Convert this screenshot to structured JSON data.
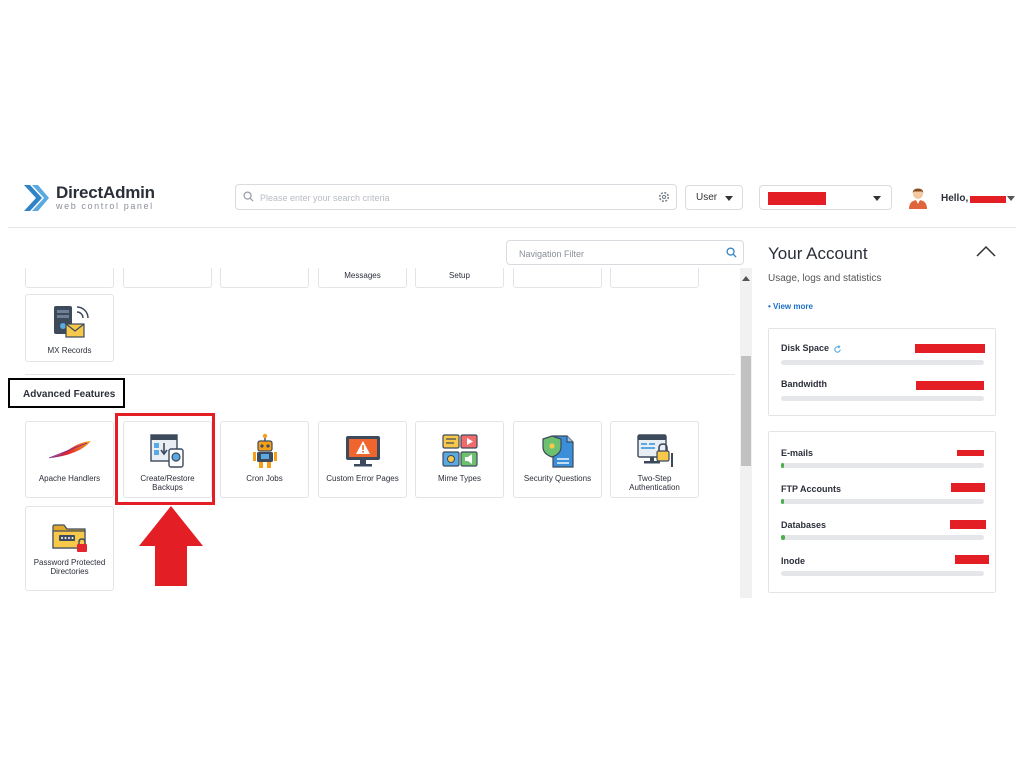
{
  "header": {
    "brand": "DirectAdmin",
    "tagline": "web control panel",
    "search_placeholder": "Please enter your search criteria",
    "role_select": "User",
    "greeting": "Hello,"
  },
  "nav_filter": {
    "placeholder": "Navigation Filter"
  },
  "top_partial_cards": [
    "",
    "",
    "",
    "Messages",
    "Setup",
    "",
    ""
  ],
  "email_section": {
    "cards": [
      {
        "label": "MX Records",
        "icon": "mx-records-icon"
      }
    ]
  },
  "advanced_features": {
    "title": "Advanced Features",
    "cards": [
      {
        "label": "Apache Handlers",
        "icon": "apache-feather-icon"
      },
      {
        "label": "Create/Restore Backups",
        "icon": "backup-icon"
      },
      {
        "label": "Cron Jobs",
        "icon": "robot-icon"
      },
      {
        "label": "Custom Error Pages",
        "icon": "error-monitor-icon"
      },
      {
        "label": "Mime Types",
        "icon": "media-types-icon"
      },
      {
        "label": "Security Questions",
        "icon": "shield-document-icon"
      },
      {
        "label": "Two-Step Authentication",
        "icon": "two-step-lock-icon"
      },
      {
        "label": "Password Protected Directories",
        "icon": "locked-folder-icon"
      }
    ]
  },
  "account": {
    "title": "Your Account",
    "subtitle": "Usage, logs and statistics",
    "view_more": "• View more",
    "usage": [
      {
        "name": "Disk Space",
        "fill": 0
      },
      {
        "name": "Bandwidth",
        "fill": 0
      }
    ],
    "counts": [
      {
        "name": "E-mails",
        "fill": 0.01
      },
      {
        "name": "FTP Accounts",
        "fill": 0.01
      },
      {
        "name": "Databases",
        "fill": 0.02
      },
      {
        "name": "Inode",
        "fill": 0
      }
    ]
  },
  "colors": {
    "accent": "#1a6fc4",
    "highlight": "#e31e24",
    "progress": "#4caf50"
  }
}
